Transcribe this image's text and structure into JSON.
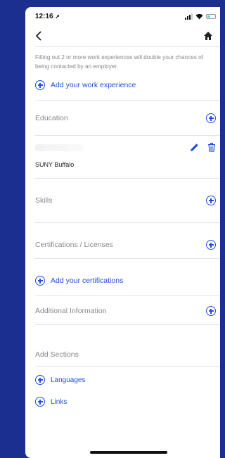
{
  "status_bar": {
    "time": "12:16"
  },
  "intro_text": "Filling out 2 or more work experiences will double your chances of being contacted by an employer.",
  "work": {
    "add_label": "Add your work experience"
  },
  "education": {
    "title": "Education",
    "school": "SUNY Buffalo"
  },
  "skills": {
    "title": "Skills"
  },
  "certifications": {
    "title": "Certifications / Licenses",
    "add_label": "Add your certifications"
  },
  "additional": {
    "title": "Additional Information"
  },
  "add_sections": {
    "title": "Add Sections",
    "items": [
      {
        "label": "Languages"
      },
      {
        "label": "Links"
      }
    ]
  },
  "colors": {
    "accent": "#1f4fd8",
    "background": "#1a2f8f",
    "muted_text": "#888888"
  },
  "icons": [
    "back-icon",
    "home-icon",
    "plus-circle-icon",
    "pencil-icon",
    "trash-icon",
    "signal-icon",
    "wifi-icon",
    "battery-icon",
    "location-arrow-icon"
  ]
}
